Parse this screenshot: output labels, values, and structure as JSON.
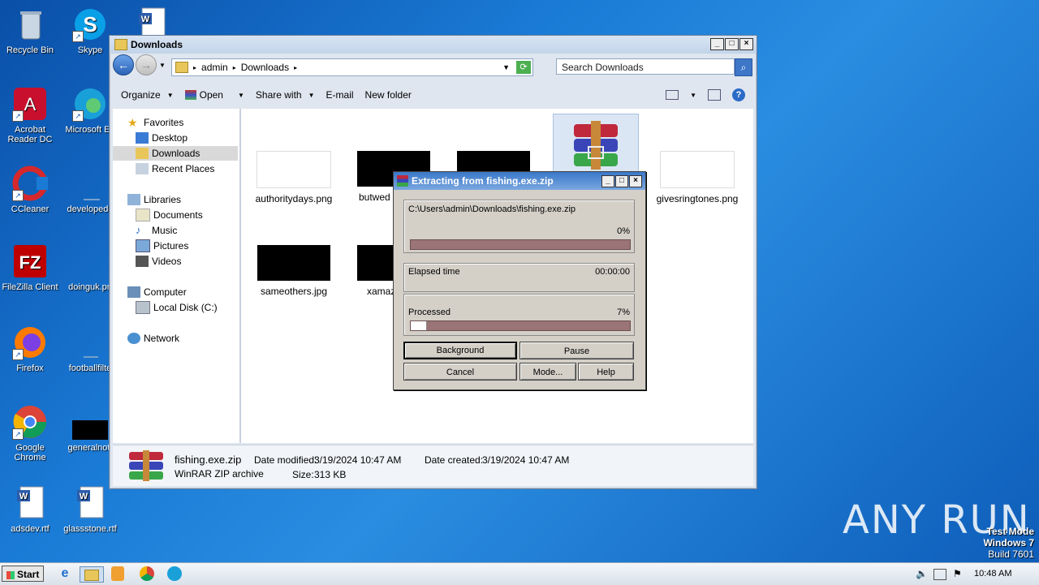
{
  "desktop": {
    "icons": [
      {
        "label": "Recycle Bin"
      },
      {
        "label": "Skype"
      },
      {
        "label": "Acrobat Reader DC"
      },
      {
        "label": "Microsoft Ed"
      },
      {
        "label": "CCleaner"
      },
      {
        "label": "developedd"
      },
      {
        "label": "FileZilla Client"
      },
      {
        "label": "doinguk.pn"
      },
      {
        "label": "Firefox"
      },
      {
        "label": "footballfilte"
      },
      {
        "label": "Google Chrome"
      },
      {
        "label": "generalnot."
      },
      {
        "label": "adsdev.rtf"
      },
      {
        "label": "glassstone.rtf"
      }
    ],
    "watermark": "ANY RUN",
    "test_mode": [
      "Test Mode",
      "Windows 7",
      "Build 7601"
    ]
  },
  "explorer": {
    "title": "Downloads",
    "breadcrumb": [
      "admin",
      "Downloads"
    ],
    "search_placeholder": "Search Downloads",
    "toolbar": [
      "Organize",
      "Open",
      "Share with",
      "E-mail",
      "New folder"
    ],
    "nav": {
      "favorites": "Favorites",
      "favorites_items": [
        "Desktop",
        "Downloads",
        "Recent Places"
      ],
      "libraries": "Libraries",
      "libraries_items": [
        "Documents",
        "Music",
        "Pictures",
        "Videos"
      ],
      "computer": "Computer",
      "computer_items": [
        "Local Disk (C:)"
      ],
      "network": "Network"
    },
    "files": [
      "authoritydays.png",
      "butwed",
      "givesringtones.png",
      "sameothers.jpg",
      "xamaz"
    ],
    "details": {
      "name": "fishing.exe.zip",
      "type": "WinRAR ZIP archive",
      "date_modified_label": "Date modified:",
      "date_modified": "3/19/2024 10:47 AM",
      "date_created_label": "Date created:",
      "date_created": "3/19/2024 10:47 AM",
      "size_label": "Size:",
      "size": "313 KB"
    }
  },
  "extract_dialog": {
    "title": "Extracting from fishing.exe.zip",
    "path": "C:\\Users\\admin\\Downloads\\fishing.exe.zip",
    "file_percent": "0%",
    "file_progress": 0.0,
    "elapsed_label": "Elapsed time",
    "elapsed": "00:00:00",
    "processed_label": "Processed",
    "processed_percent": "7%",
    "processed_progress": 0.07,
    "buttons": {
      "background": "Background",
      "pause": "Pause",
      "cancel": "Cancel",
      "mode": "Mode...",
      "help": "Help"
    }
  },
  "taskbar": {
    "start": "Start",
    "clock": "10:48 AM"
  }
}
